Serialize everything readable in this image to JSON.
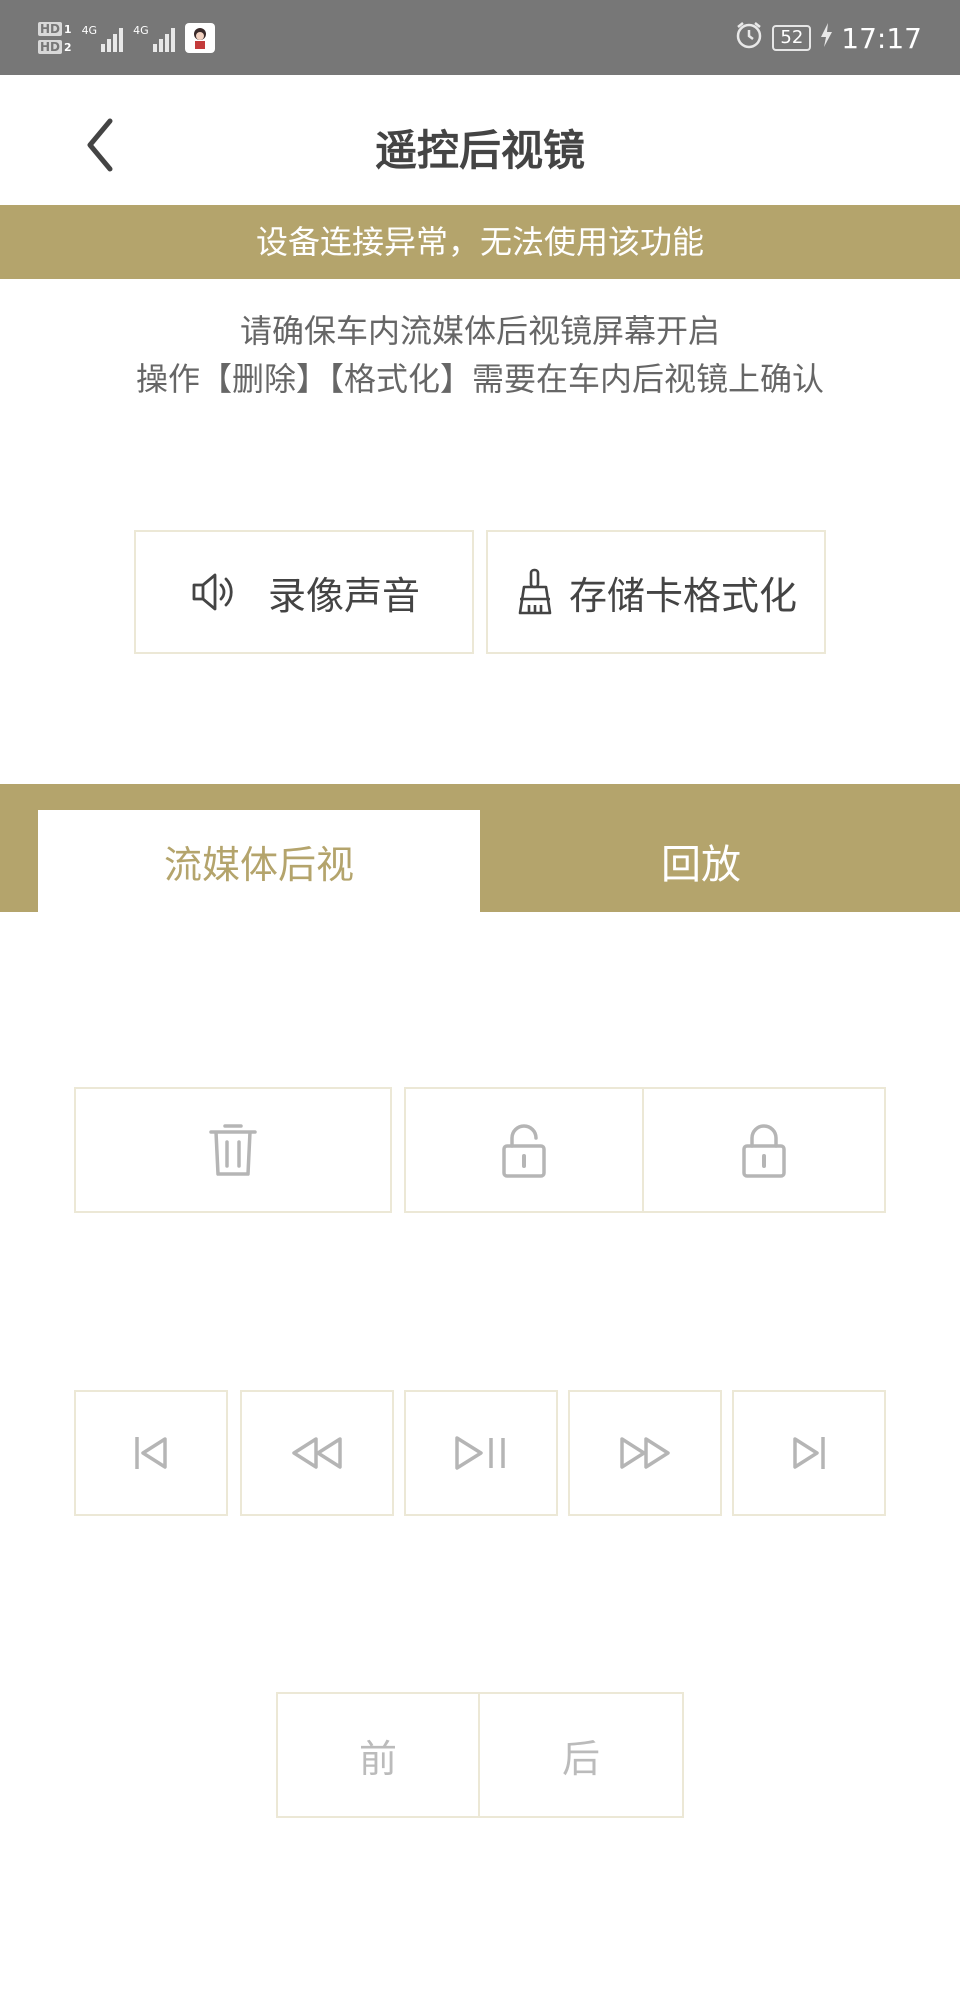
{
  "status_bar": {
    "hd1": "HD",
    "hd1_sub": "1",
    "hd2": "HD",
    "hd2_sub": "2",
    "net1": "4G",
    "net2": "4G",
    "battery": "52",
    "time": "17:17",
    "icons": [
      "signal-icon",
      "app-avatar-icon",
      "alarm-icon",
      "battery-icon",
      "charging-icon"
    ]
  },
  "header": {
    "title": "遥控后视镜",
    "back_icon": "chevron-left-icon"
  },
  "banner": {
    "text": "设备连接异常，无法使用该功能",
    "color": "#b4a46c"
  },
  "notice": {
    "line1": "请确保车内流媒体后视镜屏幕开启",
    "line2": "操作【删除】【格式化】需要在车内后视镜上确认"
  },
  "functions": {
    "record_sound": {
      "label": "录像声音",
      "icon": "speaker-icon"
    },
    "format_card": {
      "label": "存储卡格式化",
      "icon": "broom-icon"
    }
  },
  "tabs": [
    {
      "label": "流媒体后视",
      "active": true
    },
    {
      "label": "回放",
      "active": false
    }
  ],
  "file_actions": [
    {
      "icon": "trash-icon"
    },
    {
      "icon": "unlock-icon"
    },
    {
      "icon": "lock-icon"
    }
  ],
  "playback": [
    {
      "icon": "skip-previous-icon"
    },
    {
      "icon": "rewind-icon"
    },
    {
      "icon": "play-pause-icon"
    },
    {
      "icon": "fast-forward-icon"
    },
    {
      "icon": "skip-next-icon"
    }
  ],
  "camera": {
    "front": "前",
    "rear": "后"
  },
  "colors": {
    "accent": "#b4a46c",
    "statusbar": "#777777",
    "disabled": "#bbbbbb"
  }
}
